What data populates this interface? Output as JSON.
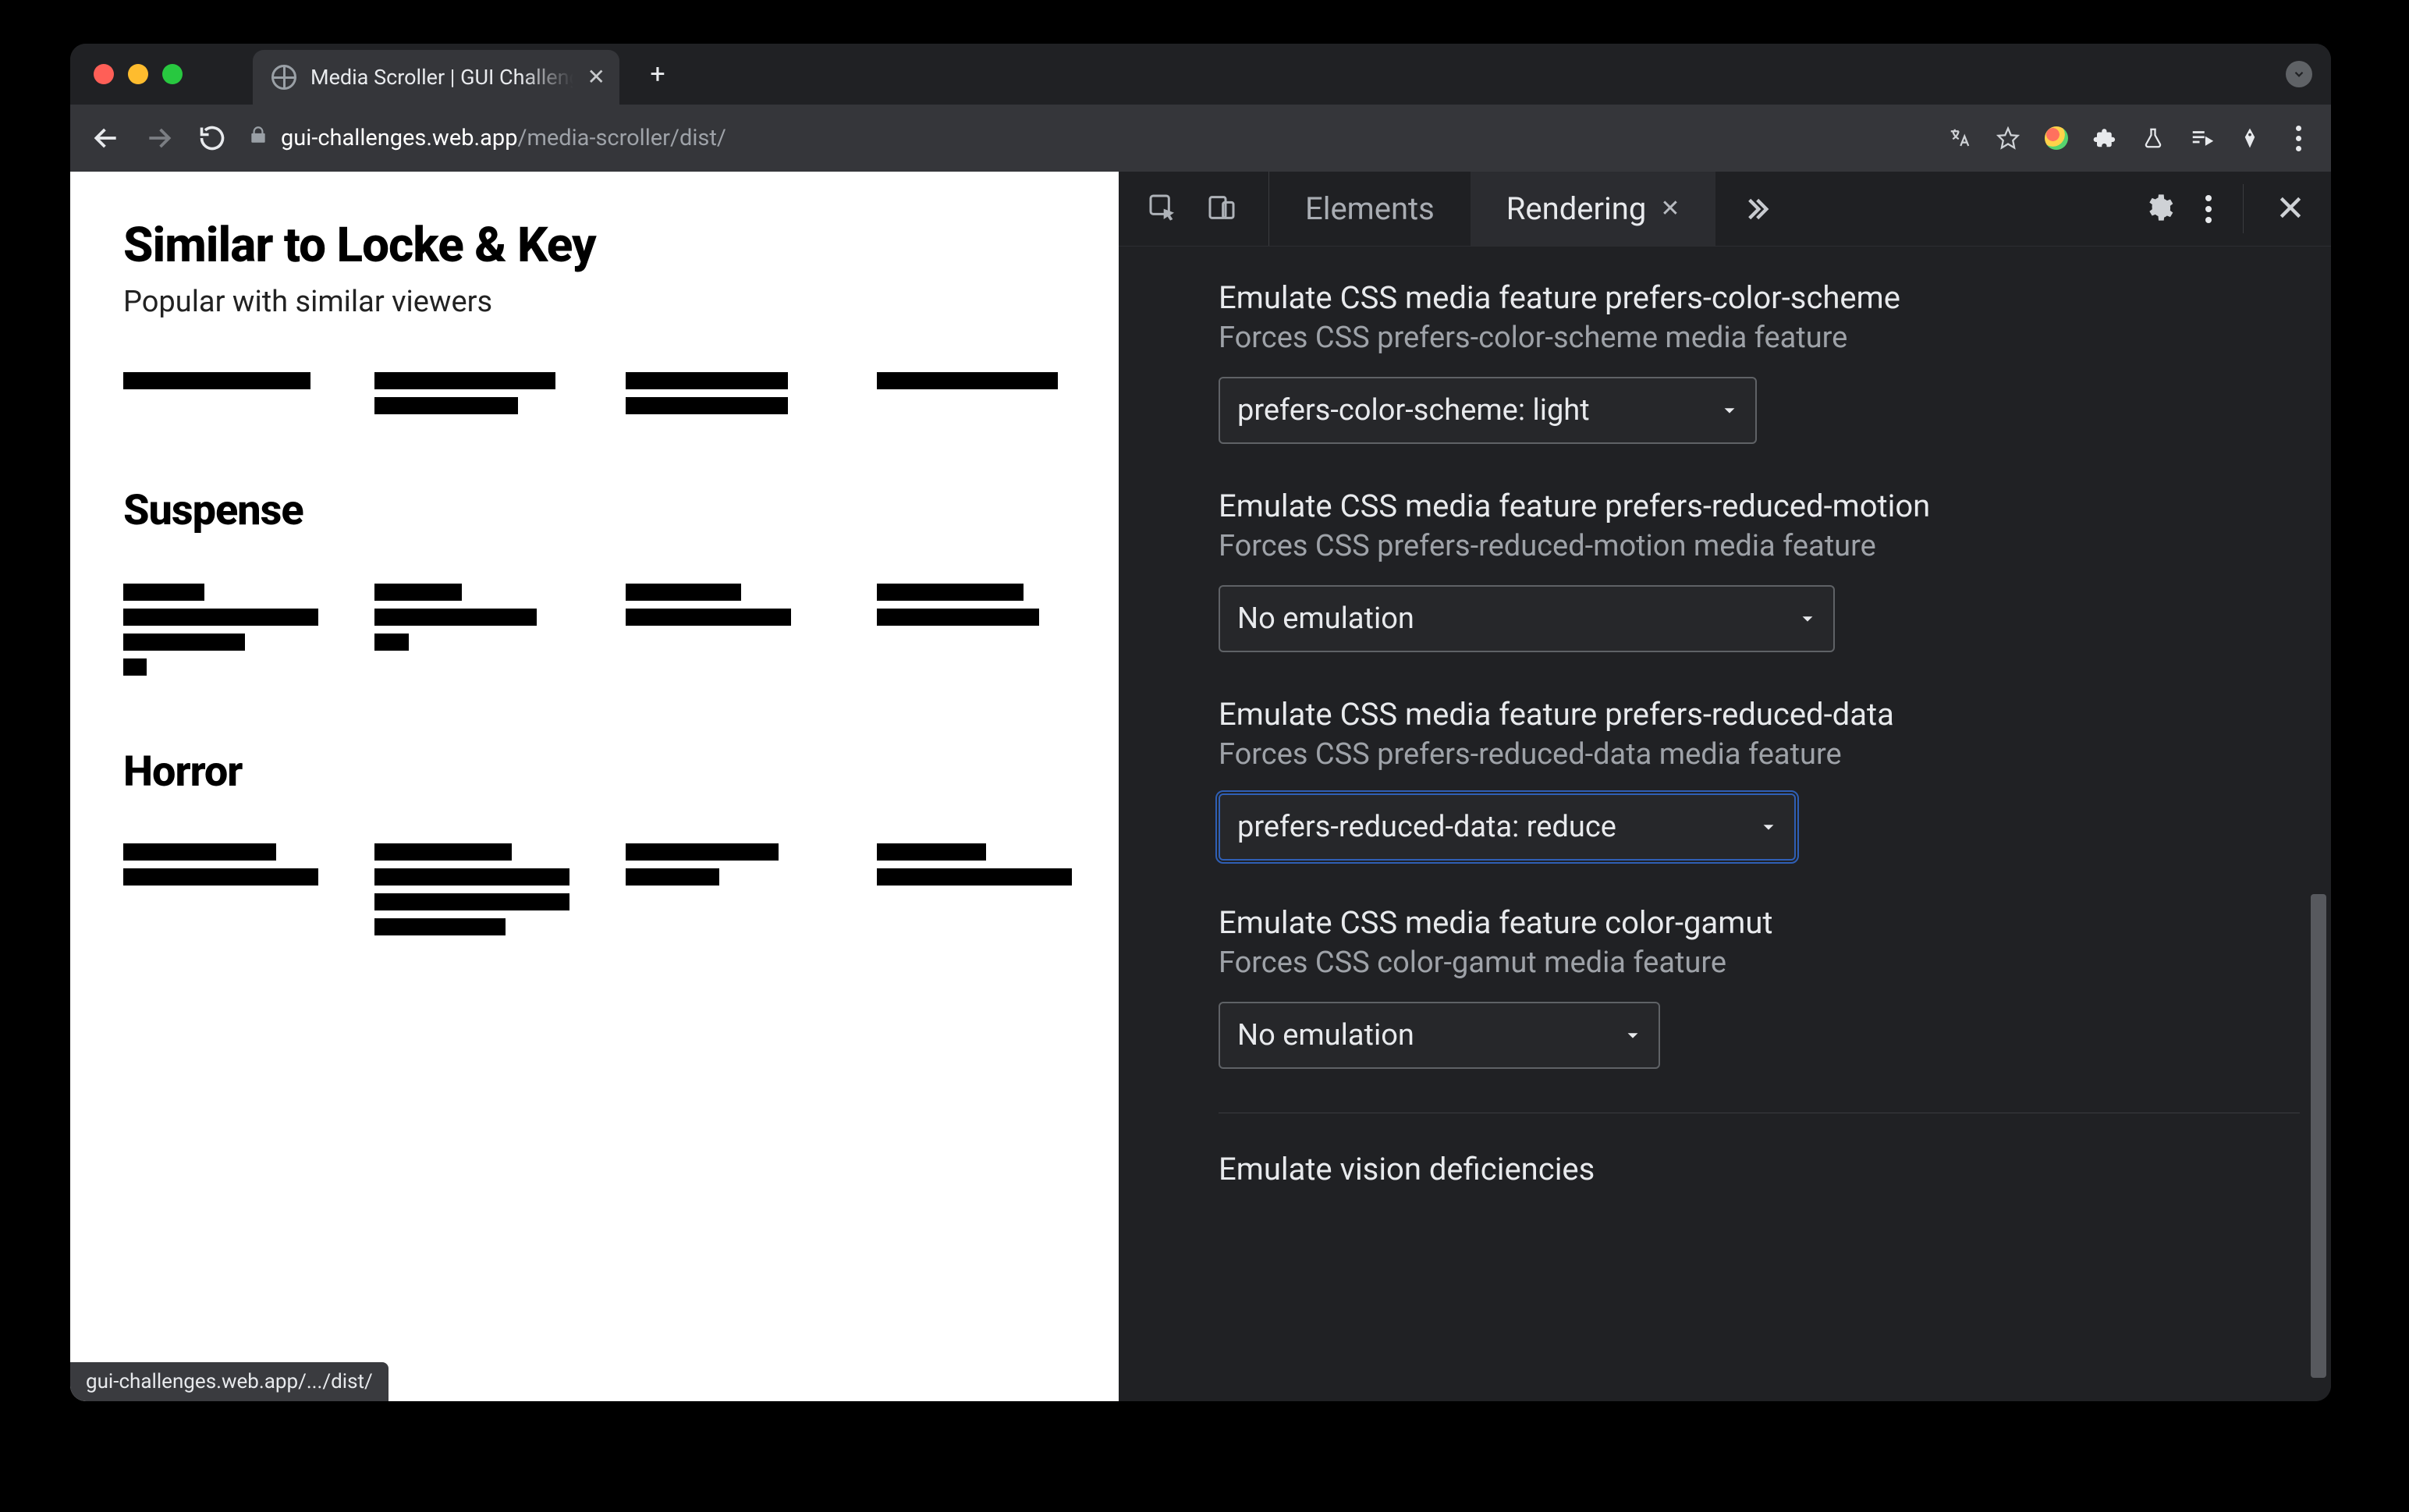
{
  "browser": {
    "tab_title": "Media Scroller | GUI Challenges",
    "url_host": "gui-challenges.web.app",
    "url_path": "/media-scroller/dist/",
    "status_text": "gui-challenges.web.app/.../dist/"
  },
  "page": {
    "section1": {
      "heading": "Similar to Locke & Key",
      "sub": "Popular with similar viewers"
    },
    "section2": {
      "heading": "Suspense"
    },
    "section3": {
      "heading": "Horror"
    }
  },
  "devtools": {
    "tabs": {
      "elements": "Elements",
      "rendering": "Rendering"
    },
    "groups": [
      {
        "title": "Emulate CSS media feature prefers-color-scheme",
        "desc": "Forces CSS prefers-color-scheme media feature",
        "value": "prefers-color-scheme: light",
        "size": "med1",
        "focused": false
      },
      {
        "title": "Emulate CSS media feature prefers-reduced-motion",
        "desc": "Forces CSS prefers-reduced-motion media feature",
        "value": "No emulation",
        "size": "wide",
        "focused": false
      },
      {
        "title": "Emulate CSS media feature prefers-reduced-data",
        "desc": "Forces CSS prefers-reduced-data media feature",
        "value": "prefers-reduced-data: reduce",
        "size": "med2",
        "focused": true
      },
      {
        "title": "Emulate CSS media feature color-gamut",
        "desc": "Forces CSS color-gamut media feature",
        "value": "No emulation",
        "size": "small",
        "focused": false
      }
    ],
    "vision": {
      "title": "Emulate vision deficiencies"
    }
  }
}
